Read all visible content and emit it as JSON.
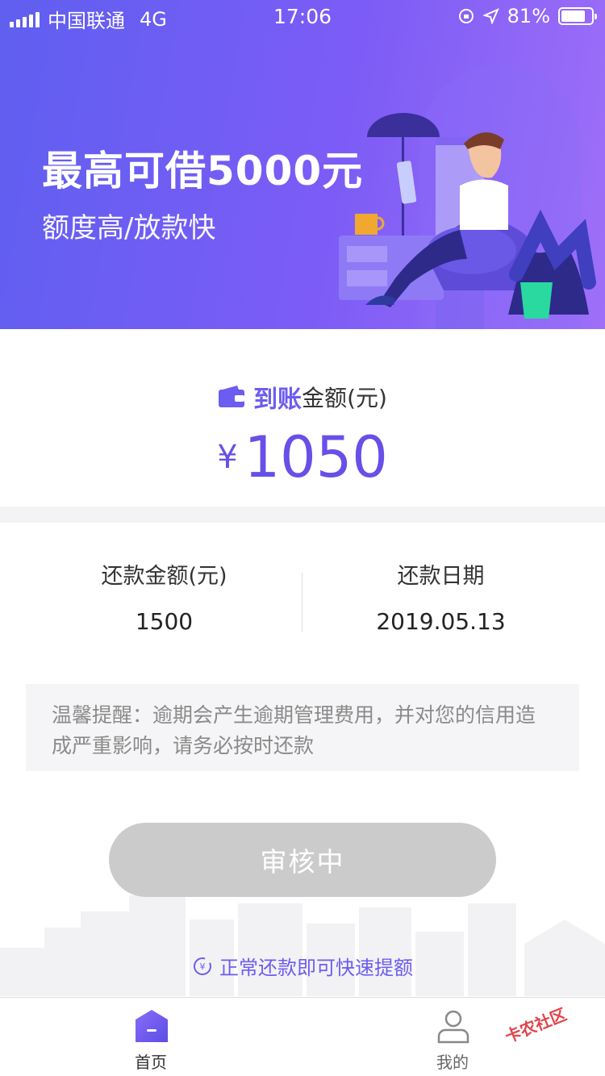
{
  "status_bar": {
    "carrier": "中国联通",
    "network": "4G",
    "time": "17:06",
    "battery_percent": "81%",
    "battery_level": 0.81
  },
  "banner": {
    "title": "最高可借5000元",
    "subtitle": "额度高/放款快"
  },
  "amount": {
    "label_strong": "到账",
    "label_rest": "金额(元)",
    "currency": "¥",
    "value": "1050",
    "accent": "#6d5cf0"
  },
  "repay": {
    "amount_label": "还款金额(元)",
    "amount_value": "1500",
    "date_label": "还款日期",
    "date_value": "2019.05.13"
  },
  "tip": {
    "text": "温馨提醒：逾期会产生逾期管理费用，并对您的信用造成严重影响，请务必按时还款"
  },
  "status_button": {
    "label": "审核中"
  },
  "promo": {
    "icon": "yen-circle-icon",
    "text": "正常还款即可快速提额"
  },
  "tabbar": {
    "items": [
      {
        "label": "首页",
        "icon": "home-icon",
        "active": true
      },
      {
        "label": "我的",
        "icon": "user-icon",
        "active": false
      }
    ]
  },
  "watermark": {
    "text": "卡农社区"
  }
}
